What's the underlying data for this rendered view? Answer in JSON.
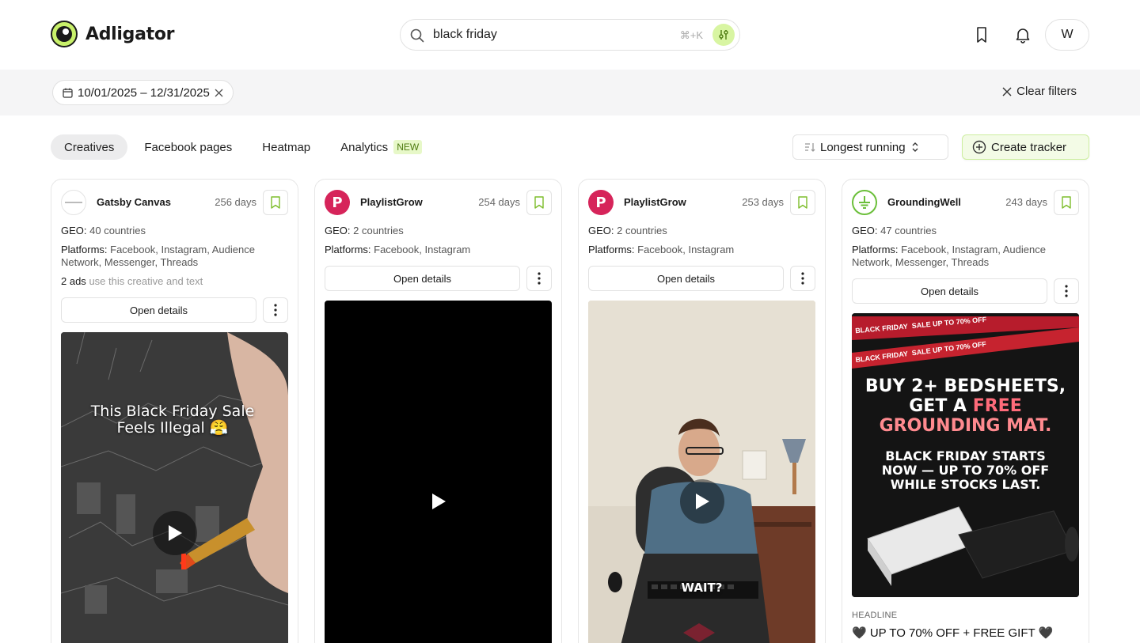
{
  "app": {
    "name": "Adligator"
  },
  "search": {
    "query": "black friday",
    "shortcut": "⌘+K"
  },
  "header": {
    "avatar_initial": "W"
  },
  "filters": {
    "date_range": "10/01/2025 – 12/31/2025",
    "clear_label": "Clear filters"
  },
  "tabs": [
    {
      "label": "Creatives",
      "active": true
    },
    {
      "label": "Facebook pages",
      "active": false
    },
    {
      "label": "Heatmap",
      "active": false
    },
    {
      "label": "Analytics",
      "active": false,
      "badge": "NEW"
    }
  ],
  "toolbar": {
    "sort_label": "Longest running",
    "create_label": "Create tracker"
  },
  "cards": [
    {
      "brand": "Gatsby Canvas",
      "days": "256 days",
      "geo_label": "GEO:",
      "geo": "40 countries",
      "platforms_label": "Platforms:",
      "platforms": "Facebook, Instagram, Audience Network, Messenger, Threads",
      "ads_count": "2 ads",
      "ads_note": "use this creative and text",
      "open_label": "Open details",
      "media_type": "video",
      "overlay_text": [
        "This Black Friday Sale",
        "Feels Illegal 😤"
      ]
    },
    {
      "brand": "PlaylistGrow",
      "days": "254 days",
      "geo_label": "GEO:",
      "geo": "2 countries",
      "platforms_label": "Platforms:",
      "platforms": "Facebook, Instagram",
      "open_label": "Open details",
      "media_type": "video"
    },
    {
      "brand": "PlaylistGrow",
      "days": "253 days",
      "geo_label": "GEO:",
      "geo": "2 countries",
      "platforms_label": "Platforms:",
      "platforms": "Facebook, Instagram",
      "open_label": "Open details",
      "media_type": "video",
      "overlay_text": [
        "WAIT?"
      ]
    },
    {
      "brand": "GroundingWell",
      "days": "243 days",
      "geo_label": "GEO:",
      "geo": "47 countries",
      "platforms_label": "Platforms:",
      "platforms": "Facebook, Instagram, Audience Network, Messenger, Threads",
      "open_label": "Open details",
      "media_type": "image",
      "banner_text": "BLACK FRIDAY",
      "banner_sale": "SALE UP TO 70% OFF",
      "ad_headline_lines": [
        "BUY 2+ BEDSHEETS,",
        "GET A",
        "FREE",
        "GROUNDING MAT."
      ],
      "ad_sub_lines": [
        "BLACK FRIDAY STARTS",
        "NOW — UP TO 70% OFF",
        "WHILE STOCKS LAST."
      ],
      "headline_label": "HEADLINE",
      "headline": "🖤 UP TO 70% OFF + FREE GIFT 🖤"
    }
  ],
  "colors": {
    "accent_green": "#c8f06a",
    "playlist_red": "#d6245a",
    "grounding_green": "#6bbf3a"
  }
}
